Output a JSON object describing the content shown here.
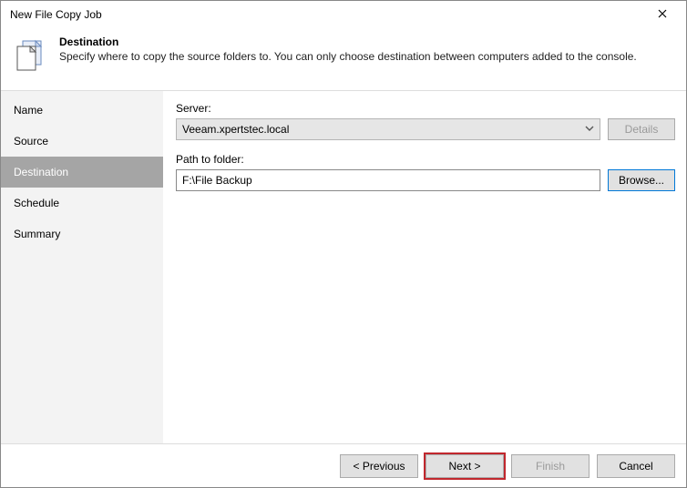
{
  "window": {
    "title": "New File Copy Job"
  },
  "header": {
    "title": "Destination",
    "subtitle": "Specify where to copy the source folders to. You can only choose destination between computers added to the console."
  },
  "sidebar": {
    "items": [
      {
        "label": "Name"
      },
      {
        "label": "Source"
      },
      {
        "label": "Destination"
      },
      {
        "label": "Schedule"
      },
      {
        "label": "Summary"
      }
    ],
    "active_index": 2
  },
  "content": {
    "server_label": "Server:",
    "server_value": "Veeam.xpertstec.local",
    "details_label": "Details",
    "path_label": "Path to folder:",
    "path_value": "F:\\File Backup",
    "browse_label": "Browse..."
  },
  "footer": {
    "previous": "< Previous",
    "next": "Next >",
    "finish": "Finish",
    "cancel": "Cancel"
  }
}
